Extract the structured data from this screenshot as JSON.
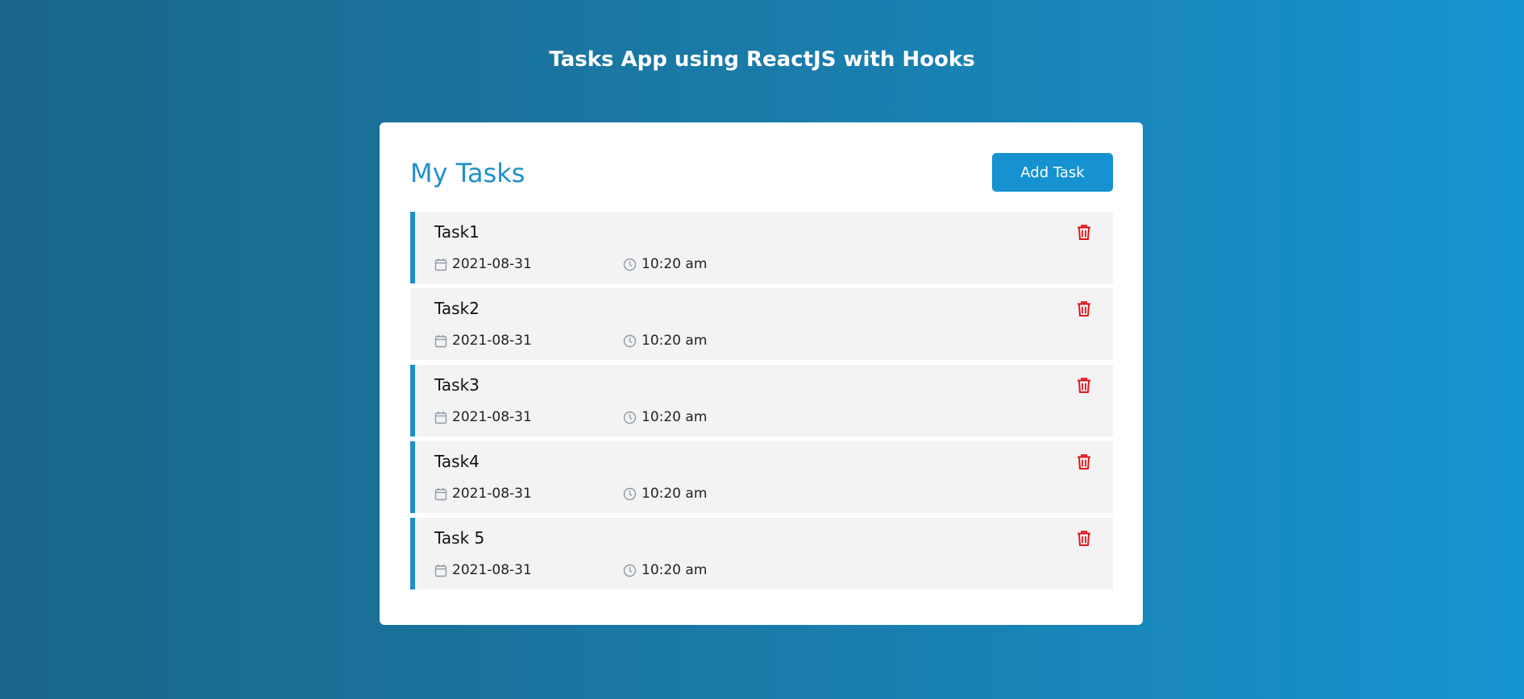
{
  "app": {
    "title": "Tasks App using ReactJS with Hooks"
  },
  "card": {
    "title": "My Tasks",
    "add_label": "Add Task"
  },
  "icons": {
    "date": "calendar-icon",
    "time": "clock-icon",
    "delete": "trash-icon"
  },
  "colors": {
    "accent": "#2190cb",
    "button": "#1592cf",
    "reminder_bar": "#1b8fcc",
    "delete": "#e0161c"
  },
  "tasks": [
    {
      "name": "Task1",
      "date": "2021-08-31",
      "time": "10:20 am",
      "reminder": true
    },
    {
      "name": "Task2",
      "date": "2021-08-31",
      "time": "10:20 am",
      "reminder": false
    },
    {
      "name": "Task3",
      "date": "2021-08-31",
      "time": "10:20 am",
      "reminder": true
    },
    {
      "name": "Task4",
      "date": "2021-08-31",
      "time": "10:20 am",
      "reminder": true
    },
    {
      "name": "Task 5",
      "date": "2021-08-31",
      "time": "10:20 am",
      "reminder": true
    }
  ]
}
